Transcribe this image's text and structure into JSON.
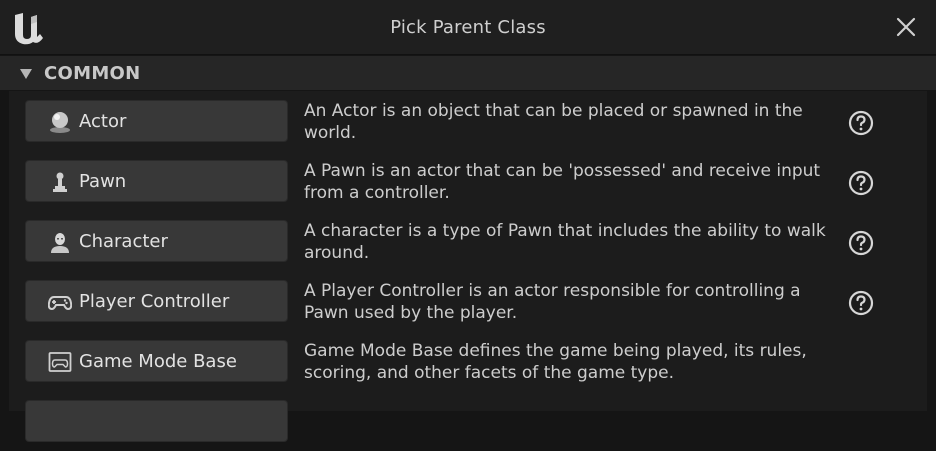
{
  "window": {
    "title": "Pick Parent Class",
    "logo_icon": "unreal-logo",
    "close_icon": "close-icon"
  },
  "section": {
    "label": "COMMON"
  },
  "classes": [
    {
      "label": "Actor",
      "icon": "actor-sphere-icon",
      "description": "An Actor is an object that can be placed or spawned in the world.",
      "has_help": true
    },
    {
      "label": "Pawn",
      "icon": "pawn-icon",
      "description": "A Pawn is an actor that can be 'possessed' and receive input from a controller.",
      "has_help": true
    },
    {
      "label": "Character",
      "icon": "character-icon",
      "description": "A character is a type of Pawn that includes the ability to walk around.",
      "has_help": true
    },
    {
      "label": "Player Controller",
      "icon": "gamepad-icon",
      "description": "A Player Controller is an actor responsible for controlling a Pawn used by the player.",
      "has_help": true
    },
    {
      "label": "Game Mode Base",
      "icon": "game-mode-icon",
      "description": "Game Mode Base defines the game being played, its rules, scoring, and other facets of the game type.",
      "has_help": false
    }
  ]
}
